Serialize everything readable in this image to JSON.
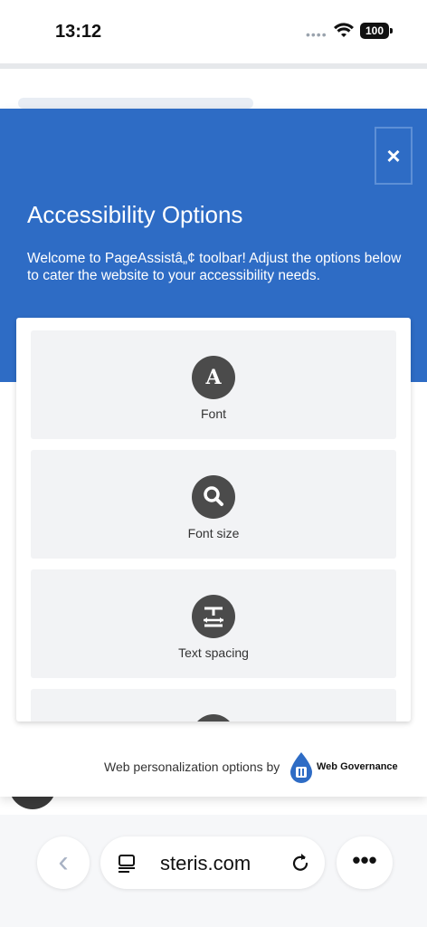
{
  "status_bar": {
    "time": "13:12",
    "battery": "100",
    "signal_icon": "signal-dots-icon",
    "wifi_icon": "wifi-icon"
  },
  "panel": {
    "title": "Accessibility Options",
    "description": "Welcome to PageAssistâ„¢ toolbar! Adjust the options below to cater the website to your accessibility needs.",
    "close_label": "×",
    "header_color": "#2e6cc5",
    "options": [
      {
        "label": "Font",
        "icon": "font-icon",
        "glyph": "A"
      },
      {
        "label": "Font size",
        "icon": "magnifier-icon",
        "glyph": ""
      },
      {
        "label": "Text spacing",
        "icon": "text-spacing-icon",
        "glyph": ""
      }
    ],
    "footer": {
      "text": "Web personalization options by",
      "brand": "Web Governance"
    }
  },
  "browser": {
    "url": "steris.com",
    "more_label": "•••",
    "back_label": "‹"
  }
}
